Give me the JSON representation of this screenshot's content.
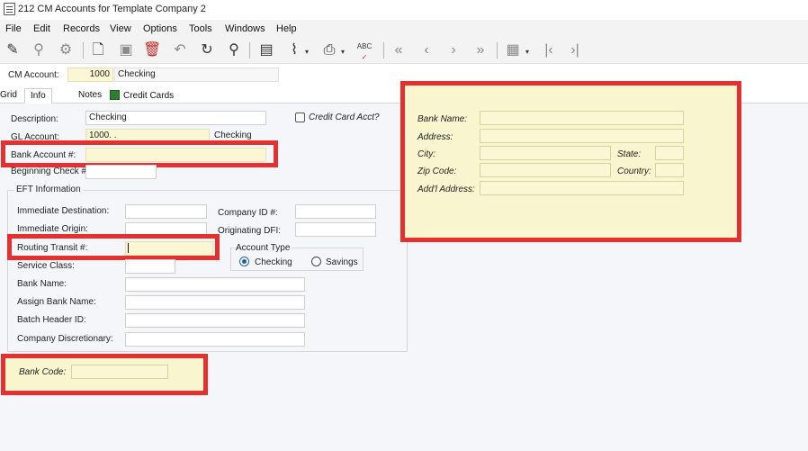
{
  "window": {
    "title": "212 CM Accounts for Template Company 2"
  },
  "menu": {
    "file": "File",
    "edit": "Edit",
    "records": "Records",
    "view": "View",
    "options": "Options",
    "tools": "Tools",
    "windows": "Windows",
    "help": "Help"
  },
  "toolbar": {
    "icons": [
      "edit-icon",
      "find-icon",
      "settings-icon",
      "new-record-icon",
      "save-icon",
      "delete-icon",
      "undo-icon",
      "refresh-icon",
      "search-icon",
      "calculator-icon",
      "attach-icon",
      "print-icon",
      "spellcheck-icon",
      "first-record-icon",
      "previous-record-icon",
      "next-record-icon",
      "last-record-icon",
      "grid-view-icon",
      "first-page-icon",
      "last-page-icon"
    ],
    "spell_label": "ABC"
  },
  "cm_account": {
    "label": "CM Account:",
    "value": "1000",
    "name": "Checking"
  },
  "tabs": {
    "grid": "Grid",
    "info": "Info",
    "notes": "Notes",
    "credit_cards": "Credit Cards"
  },
  "info": {
    "description_label": "Description:",
    "description_value": "Checking",
    "credit_card_label": "Credit Card Acct?",
    "gl_account_label": "GL Account:",
    "gl_account_value": "1000.  .",
    "gl_account_desc": "Checking",
    "bank_account_label": "Bank Account #:",
    "bank_account_value": "",
    "beginning_check_label": "Beginning Check #:",
    "beginning_check_value": ""
  },
  "eft": {
    "group_label": "EFT Information",
    "immediate_destination_label": "Immediate Destination:",
    "immediate_origin_label": "Immediate Origin:",
    "routing_transit_label": "Routing Transit #:",
    "service_class_label": "Service Class:",
    "bank_name_label": "Bank Name:",
    "assign_bank_name_label": "Assign Bank Name:",
    "batch_header_label": "Batch Header ID:",
    "company_discretionary_label": "Company Discretionary:",
    "company_id_label": "Company ID #:",
    "originating_dfi_label": "Originating DFI:",
    "account_type_label": "Account Type",
    "checking_label": "Checking",
    "savings_label": "Savings",
    "account_type_selected": "Checking"
  },
  "bank_code": {
    "label": "Bank Code:",
    "value": ""
  },
  "bank_panel": {
    "bank_name_label": "Bank Name:",
    "address_label": "Address:",
    "city_label": "City:",
    "state_label": "State:",
    "zip_label": "Zip Code:",
    "country_label": "Country:",
    "addl_address_label": "Add'l Address:"
  },
  "colors": {
    "highlight_box": "#e53030",
    "yellow_field": "#fbf7d4",
    "radio_selected": "#1a5fb4"
  }
}
